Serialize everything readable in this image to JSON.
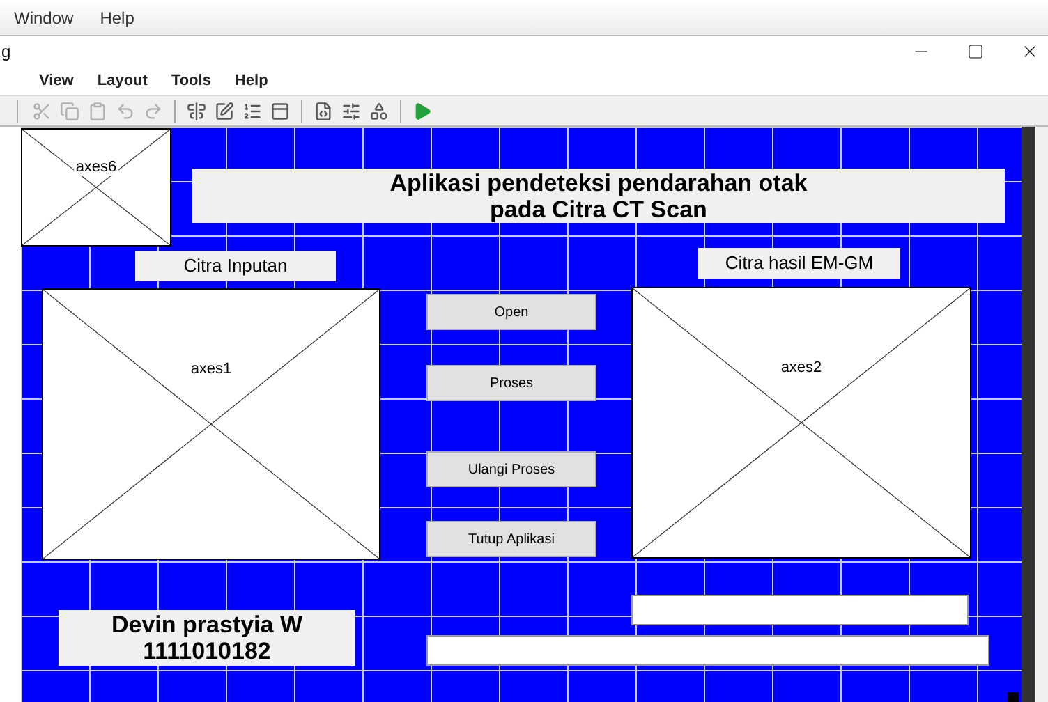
{
  "app_menu": [
    "Window",
    "Help"
  ],
  "window": {
    "title": "g"
  },
  "menu": [
    "View",
    "Layout",
    "Tools",
    "Help"
  ],
  "toolbar": [
    {
      "disabled": true
    },
    {
      "disabled": true
    },
    {
      "disabled": true
    },
    {
      "disabled": true
    },
    {
      "disabled": true
    },
    {
      "disabled": false
    },
    {
      "disabled": false
    },
    {
      "disabled": false
    },
    {
      "disabled": false
    },
    {
      "disabled": false
    },
    {
      "disabled": false
    },
    {
      "disabled": false
    },
    {
      "disabled": false
    }
  ],
  "components": [
    {
      "kind": "axes",
      "label": "axes6"
    },
    {
      "kind": "static_text",
      "text": "Aplikasi pendeteksi pendarahan otak\npada Citra CT Scan"
    },
    {
      "kind": "static_text",
      "text": "Citra Inputan"
    },
    {
      "kind": "static_text",
      "text": "Citra hasil EM-GM"
    },
    {
      "kind": "axes",
      "label": "axes1"
    },
    {
      "kind": "axes",
      "label": "axes2"
    },
    {
      "kind": "push_button",
      "text": "Open"
    },
    {
      "kind": "push_button",
      "text": "Proses"
    },
    {
      "kind": "push_button",
      "text": "Ulangi Proses"
    },
    {
      "kind": "push_button",
      "text": "Tutup Aplikasi"
    },
    {
      "kind": "static_text",
      "text": "Devin prastyia W\n1111010182"
    },
    {
      "kind": "edit"
    },
    {
      "kind": "edit"
    }
  ]
}
